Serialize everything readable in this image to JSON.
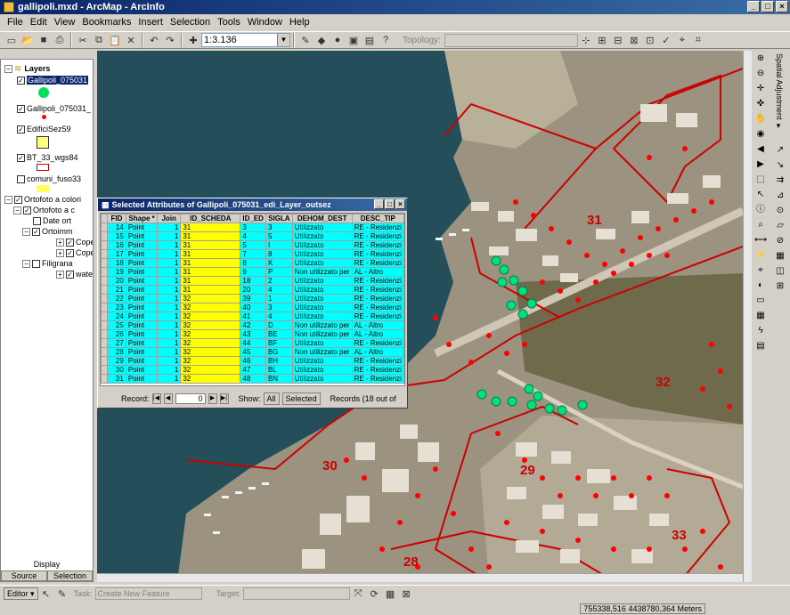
{
  "window": {
    "title": "gallipoli.mxd - ArcMap - ArcInfo",
    "min": "_",
    "max": "□",
    "close": "×"
  },
  "menu": [
    "File",
    "Edit",
    "View",
    "Bookmarks",
    "Insert",
    "Selection",
    "Tools",
    "Window",
    "Help"
  ],
  "toolbar": {
    "scale": "1:3.136",
    "topology_label": "Topology:"
  },
  "toc": {
    "layers_label": "Layers",
    "items": [
      {
        "label": "Gallipoli_075031"
      },
      {
        "label": "Gallipoli_075031_"
      },
      {
        "label": "EdificiSez59"
      },
      {
        "label": "BT_33_wgs84"
      },
      {
        "label": "comuni_fuso33"
      },
      {
        "label": "Ortofoto a colori"
      },
      {
        "label": "Ortofoto a c"
      },
      {
        "label": "Date ort"
      },
      {
        "label": "Ortoimm"
      },
      {
        "label": "Cope"
      },
      {
        "label": "Cope"
      },
      {
        "label": "Filigrana"
      },
      {
        "label": "wate"
      }
    ],
    "display_label": "Display",
    "tabs": {
      "source": "Source",
      "selection": "Selection"
    }
  },
  "map_labels": [
    "31",
    "32",
    "30",
    "29",
    "33",
    "28"
  ],
  "attributes": {
    "title": "Selected Attributes of Gallipoli_075031_edi_Layer_outsez",
    "columns": [
      "FID",
      "Shape *",
      "Join",
      "ID_SCHEDA",
      "ID_ED",
      "SIGLA",
      "DEHOM_DEST",
      "DESC_TIP"
    ],
    "rows": [
      [
        "14",
        "Point",
        "1",
        "31",
        "3",
        "3",
        "Utilizzato",
        "RE - Residenzi"
      ],
      [
        "15",
        "Point",
        "1",
        "31",
        "4",
        "5",
        "Utilizzato",
        "RE - Residenzi"
      ],
      [
        "16",
        "Point",
        "1",
        "31",
        "5",
        "I",
        "Utilizzato",
        "RE - Residenzi"
      ],
      [
        "17",
        "Point",
        "1",
        "31",
        "7",
        "8",
        "Utilizzato",
        "RE - Residenzi"
      ],
      [
        "18",
        "Point",
        "1",
        "31",
        "8",
        "K",
        "Utilizzato",
        "RE - Residenzi"
      ],
      [
        "19",
        "Point",
        "1",
        "31",
        "9",
        "P",
        "Non utilizzato per",
        "AL - Altro"
      ],
      [
        "20",
        "Point",
        "1",
        "31",
        "18",
        "2",
        "Utilizzato",
        "RE - Residenzi"
      ],
      [
        "21",
        "Point",
        "1",
        "31",
        "20",
        "4",
        "Utilizzato",
        "RE - Residenzi"
      ],
      [
        "22",
        "Point",
        "1",
        "32",
        "39",
        "1",
        "Utilizzato",
        "RE - Residenzi"
      ],
      [
        "23",
        "Point",
        "1",
        "32",
        "40",
        "3",
        "Utilizzato",
        "RE - Residenzi"
      ],
      [
        "24",
        "Point",
        "1",
        "32",
        "41",
        "4",
        "Utilizzato",
        "RE - Residenzi"
      ],
      [
        "25",
        "Point",
        "1",
        "32",
        "42",
        "D",
        "Non utilizzato per",
        "AL - Altro"
      ],
      [
        "26",
        "Point",
        "1",
        "32",
        "43",
        "BE",
        "Non utilizzato per",
        "AL - Altro"
      ],
      [
        "27",
        "Point",
        "1",
        "32",
        "44",
        "BF",
        "Utilizzato",
        "RE - Residenzi"
      ],
      [
        "28",
        "Point",
        "1",
        "32",
        "45",
        "BG",
        "Non utilizzato per",
        "AL - Altro"
      ],
      [
        "29",
        "Point",
        "1",
        "32",
        "46",
        "BH",
        "Utilizzato",
        "RE - Residenzi"
      ],
      [
        "30",
        "Point",
        "1",
        "32",
        "47",
        "BL",
        "Utilizzato",
        "RE - Residenzi"
      ],
      [
        "31",
        "Point",
        "1",
        "32",
        "48",
        "BN",
        "Utilizzato",
        "RE - Residenzi"
      ]
    ],
    "record_label": "Record:",
    "record_value": "0",
    "show_label": "Show:",
    "all_label": "All",
    "selected_label": "Selected",
    "records_info": "Records (18 out of"
  },
  "editor": {
    "label": "Editor ▾",
    "task_label": "Task:",
    "task_value": "Create New Feature",
    "target_label": "Target:"
  },
  "status": {
    "coords": "755338,516  4438780,364 Meters"
  },
  "side": {
    "spatial_adjustment": "Spatial Adjustment ▾"
  },
  "colors": {
    "title": "#0a246a",
    "selected_row": "#00ffff",
    "id_scheda": "#ffff00",
    "boundary": "#cc0000",
    "point_red": "#ff0000",
    "point_green": "#00e060"
  }
}
